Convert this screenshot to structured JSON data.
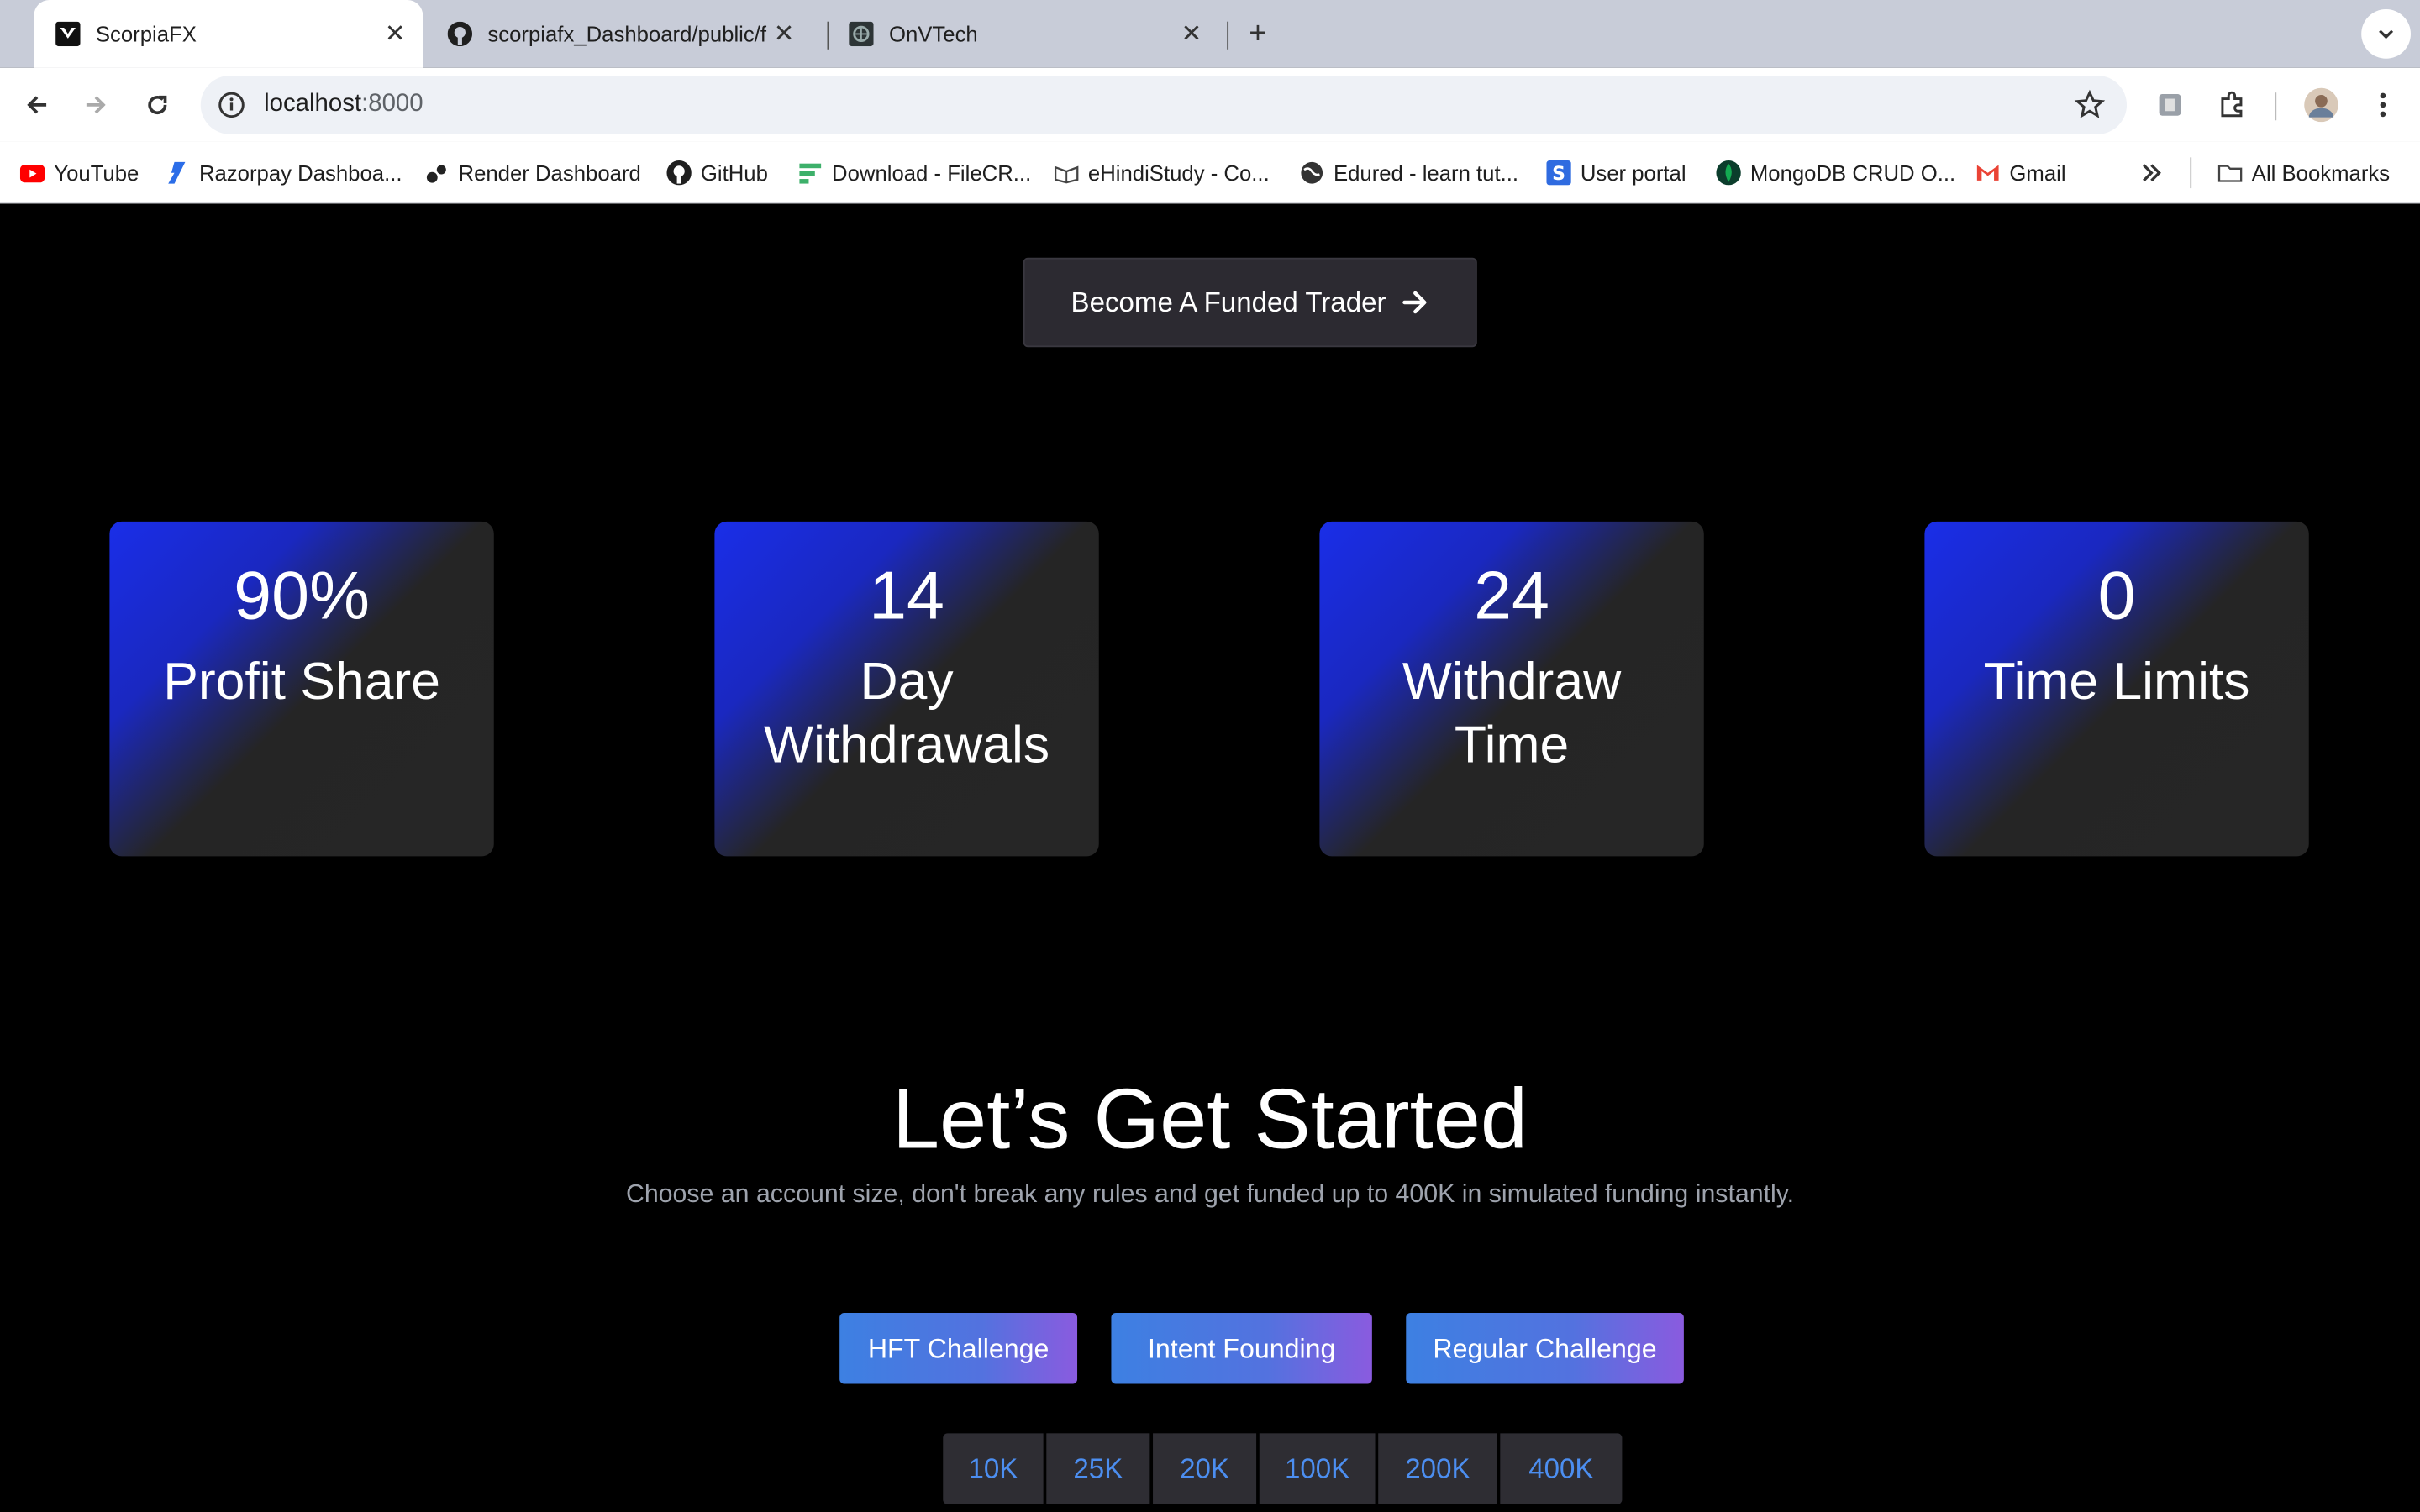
{
  "browser": {
    "tabs": [
      {
        "title": "ScorpiaFX",
        "active": true
      },
      {
        "title": "scorpiafx_Dashboard/public/f",
        "active": false
      },
      {
        "title": "OnVTech",
        "active": false
      }
    ],
    "url_host": "localhost",
    "url_port": ":8000",
    "bookmarks": [
      {
        "label": "YouTube",
        "icon": "youtube-icon",
        "color": "#ff0000"
      },
      {
        "label": "Razorpay Dashboa...",
        "icon": "razorpay-icon",
        "color": "#2b6de8"
      },
      {
        "label": "Render Dashboard",
        "icon": "render-icon",
        "color": "#222222"
      },
      {
        "label": "GitHub",
        "icon": "github-icon",
        "color": "#1f1f1f"
      },
      {
        "label": "Download - FileCR...",
        "icon": "filecr-icon",
        "color": "#3db06a"
      },
      {
        "label": "eHindiStudy - Co...",
        "icon": "ehindistudy-icon",
        "color": "#444444"
      },
      {
        "label": "Edured - learn tut...",
        "icon": "globe-icon",
        "color": "#333333"
      },
      {
        "label": "User portal",
        "icon": "user-portal-icon",
        "color": "#2f6be0"
      },
      {
        "label": "MongoDB CRUD O...",
        "icon": "mongodb-icon",
        "color": "#13aa52"
      },
      {
        "label": "Gmail",
        "icon": "gmail-icon",
        "color": "#ea4335"
      }
    ],
    "all_bookmarks_label": "All Bookmarks"
  },
  "page": {
    "cta_label": "Become A Funded Trader",
    "stats": [
      {
        "number": "90%",
        "label": "Profit Share"
      },
      {
        "number": "14",
        "label": "Day Withdrawals"
      },
      {
        "number": "24",
        "label": "Withdraw Time"
      },
      {
        "number": "0",
        "label": "Time Limits"
      }
    ],
    "heading": "Let’s Get Started",
    "subheading": "Choose an account size, don't break any rules and get funded up to 400K in simulated funding instantly.",
    "challenges": [
      "HFT Challenge",
      "Intent Founding",
      "Regular Challenge"
    ],
    "sizes": [
      "10K",
      "25K",
      "20K",
      "100K",
      "200K",
      "400K"
    ]
  },
  "colors": {
    "accent_blue": "#1a2ee8",
    "button_gradient_start": "#3d80e2",
    "button_gradient_end": "#8a5bdf",
    "size_text": "#4c8ef0"
  }
}
